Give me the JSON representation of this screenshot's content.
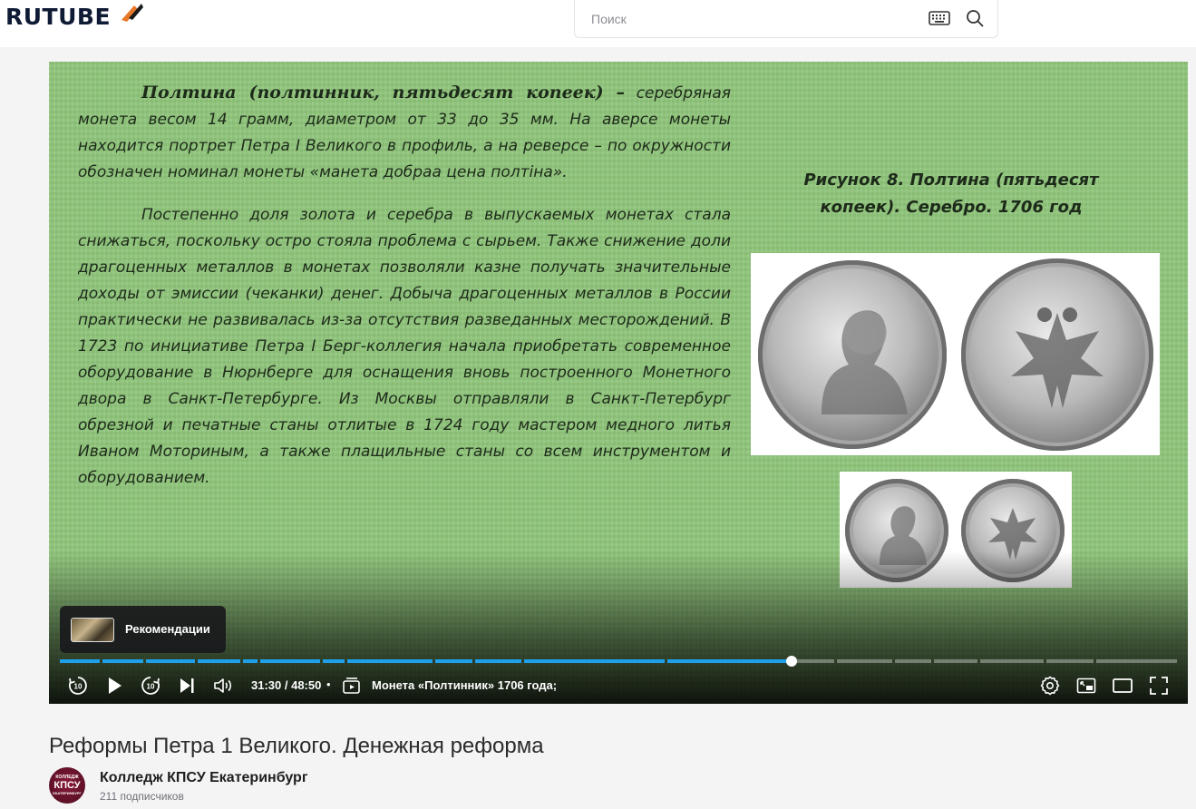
{
  "header": {
    "logo_text": "RUTUBE",
    "search_placeholder": "Поиск"
  },
  "slide": {
    "heading": "Полтина (полтинник, пятьдесят копеек) –",
    "para1": "серебряная монета весом 14 грамм, диаметром от 33 до 35 мм. На аверсе монеты находится портрет Петра I Великого в профиль, а на реверсе – по окружности обозначен номинал монеты «манета добраа цена полтіна».",
    "para2": "Постепенно доля золота и серебра в выпускаемых монетах стала снижаться, поскольку остро стояла проблема с сырьем. Также снижение доли драгоценных металлов в монетах позволяли казне получать значительные доходы от эмиссии (чеканки) денег. Добыча драгоценных металлов в России практически не развивалась из-за отсутствия разведанных месторождений. В 1723 по инициативе Петра I Берг-коллегия начала приобретать современное оборудование в Нюрнберге для оснащения вновь построенного Монетного двора в Санкт-Петербурге. Из Москвы отправляли в Санкт-Петербург обрезной и печатные станы отлитые в 1724 году мастером медного литья Иваном Моториным, а также плащильные станы со всем инструментом и оборудованием.",
    "caption": "Рисунок 8. Полтина (пятьдесят копеек). Серебро. 1706 год"
  },
  "player": {
    "recommendations_label": "Рекомендации",
    "time": "31:30 / 48:50",
    "separator": "•",
    "chapter": "Монета «Полтинник» 1706 года;",
    "progress_fraction": 0.645,
    "accent_color": "#1fa0ea"
  },
  "video": {
    "title": "Реформы Петра 1 Великого. Денежная реформа"
  },
  "channel": {
    "name": "Колледж КПСУ Екатеринбург",
    "subscribers": "211 подписчиков",
    "avatar_line1": "КОЛЛЕДЖ",
    "avatar_line2": "КПСУ",
    "avatar_line3": "ЕКАТЕРИНБУРГ"
  }
}
